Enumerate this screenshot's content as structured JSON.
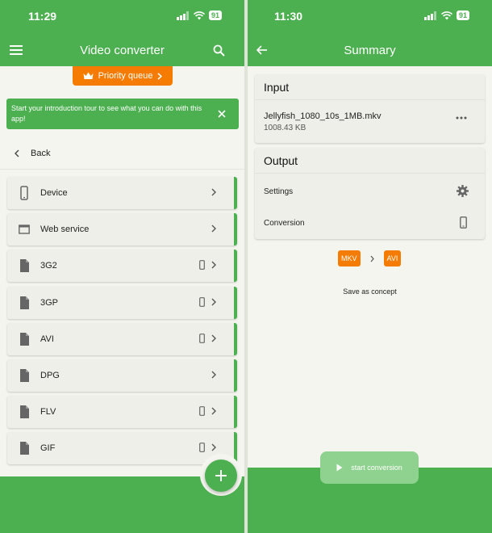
{
  "left": {
    "status": {
      "time": "11:29",
      "battery": "91"
    },
    "appbar": {
      "title": "Video converter",
      "menu_icon": "hamburger-menu-icon",
      "search_icon": "search-icon"
    },
    "priority_queue": {
      "label": "Priority queue",
      "icon": "crown-icon"
    },
    "tour_banner": {
      "text": "Start your introduction tour to see what you can do with this app!"
    },
    "back": {
      "label": "Back"
    },
    "formats": [
      {
        "label": "Device",
        "icon": "phone-icon",
        "phone": false
      },
      {
        "label": "Web service",
        "icon": "browser-window-icon",
        "phone": false
      },
      {
        "label": "3G2",
        "icon": "file-icon",
        "phone": true
      },
      {
        "label": "3GP",
        "icon": "file-icon",
        "phone": true
      },
      {
        "label": "AVI",
        "icon": "file-icon",
        "phone": true
      },
      {
        "label": "DPG",
        "icon": "file-icon",
        "phone": false
      },
      {
        "label": "FLV",
        "icon": "file-icon",
        "phone": true
      },
      {
        "label": "GIF",
        "icon": "file-icon",
        "phone": true
      }
    ],
    "fab_icon": "plus-icon"
  },
  "right": {
    "status": {
      "time": "11:30",
      "battery": "91"
    },
    "appbar": {
      "title": "Summary",
      "back_icon": "arrow-left-icon"
    },
    "input": {
      "title": "Input",
      "file_name": "Jellyfish_1080_10s_1MB.mkv",
      "file_size": "1008.43 KB"
    },
    "output": {
      "title": "Output",
      "settings_label": "Settings",
      "conversion_label": "Conversion"
    },
    "conversion_from": "MKV",
    "conversion_to": "AVI",
    "save_as_concept": "Save as concept",
    "start_conversion": "start conversion"
  },
  "colors": {
    "primary": "#4caf50",
    "accent": "#f57c00",
    "background": "#f3f5ee"
  }
}
